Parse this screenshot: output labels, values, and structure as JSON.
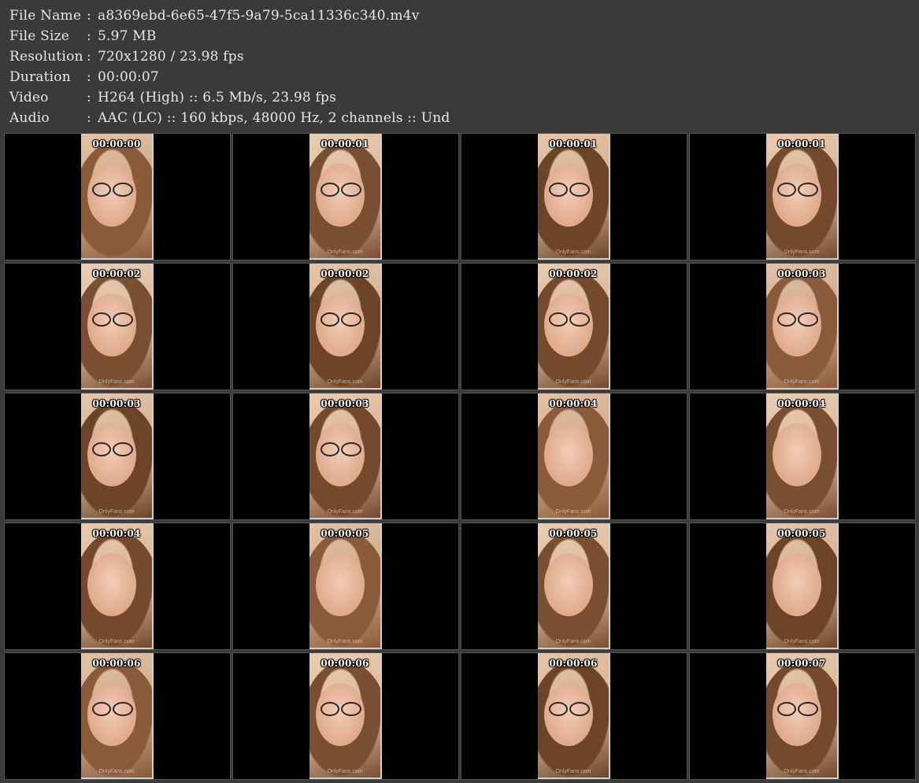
{
  "info": [
    {
      "label": "File Name",
      "sep": ":",
      "value": "a8369ebd-6e65-47f5-9a79-5ca11336c340.m4v"
    },
    {
      "label": "File Size",
      "sep": ":",
      "value": "5.97 MB"
    },
    {
      "label": "Resolution",
      "sep": ":",
      "value": "720x1280 / 23.98 fps"
    },
    {
      "label": "Duration",
      "sep": ":",
      "value": "00:00:07"
    },
    {
      "label": "Video",
      "sep": ":",
      "value": "H264 (High) :: 6.5 Mb/s, 23.98 fps"
    },
    {
      "label": "Audio",
      "sep": ":",
      "value": "AAC (LC) :: 160 kbps, 48000 Hz, 2 channels :: Und"
    }
  ],
  "thumbnails": [
    {
      "time": "00:00:00",
      "watermark": ""
    },
    {
      "time": "00:00:01",
      "watermark": "OnlyFans.com"
    },
    {
      "time": "00:00:01",
      "watermark": "OnlyFans.com"
    },
    {
      "time": "00:00:01",
      "watermark": "OnlyFans.com"
    },
    {
      "time": "00:00:02",
      "watermark": "OnlyFans.com"
    },
    {
      "time": "00:00:02",
      "watermark": "OnlyFans.com"
    },
    {
      "time": "00:00:02",
      "watermark": "OnlyFans.com"
    },
    {
      "time": "00:00:03",
      "watermark": "OnlyFans.com"
    },
    {
      "time": "00:00:03",
      "watermark": "OnlyFans.com"
    },
    {
      "time": "00:00:03",
      "watermark": "OnlyFans.com"
    },
    {
      "time": "00:00:04",
      "watermark": "OnlyFans.com"
    },
    {
      "time": "00:00:04",
      "watermark": "OnlyFans.com"
    },
    {
      "time": "00:00:04",
      "watermark": "OnlyFans.com"
    },
    {
      "time": "00:00:05",
      "watermark": "OnlyFans.com"
    },
    {
      "time": "00:00:05",
      "watermark": "OnlyFans.com"
    },
    {
      "time": "00:00:05",
      "watermark": "OnlyFans.com"
    },
    {
      "time": "00:00:06",
      "watermark": "OnlyFans.com"
    },
    {
      "time": "00:00:06",
      "watermark": "OnlyFans.com"
    },
    {
      "time": "00:00:06",
      "watermark": "OnlyFans.com"
    },
    {
      "time": "00:00:07",
      "watermark": "OnlyFans.com"
    }
  ],
  "colors": {
    "background": "#3a3a3a",
    "cell": "#000000",
    "text": "#e8e8e8",
    "timestamp": "#ffffff"
  }
}
